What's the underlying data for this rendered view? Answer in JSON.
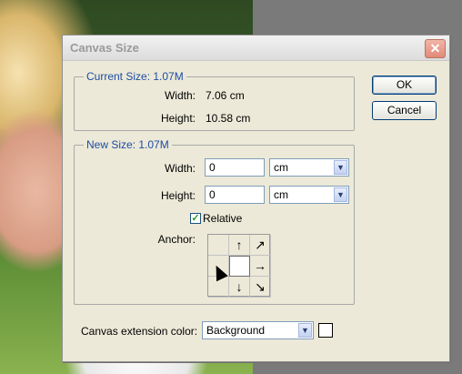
{
  "dialog": {
    "title": "Canvas Size",
    "close_glyph": "✕",
    "current_size": {
      "label": "Current Size: 1.07M",
      "width_label": "Width:",
      "width_value": "7.06 cm",
      "height_label": "Height:",
      "height_value": "10.58 cm"
    },
    "new_size": {
      "label": "New Size: 1.07M",
      "width_label": "Width:",
      "width_value": "0",
      "width_unit": "cm",
      "height_label": "Height:",
      "height_value": "0",
      "height_unit": "cm",
      "relative_label": "Relative",
      "relative_checked": true,
      "anchor_label": "Anchor:"
    },
    "extension": {
      "label": "Canvas extension color:",
      "value": "Background",
      "swatch_color": "#ffffff"
    },
    "buttons": {
      "ok": "OK",
      "cancel": "Cancel"
    }
  },
  "icons": {
    "close": "close-icon",
    "dropdown": "chevron-down-icon",
    "check": "check-icon"
  },
  "colors": {
    "group_title": "#1e4ca3",
    "dialog_bg": "#ece9d8",
    "canvas_gray": "#7a7a7a"
  }
}
